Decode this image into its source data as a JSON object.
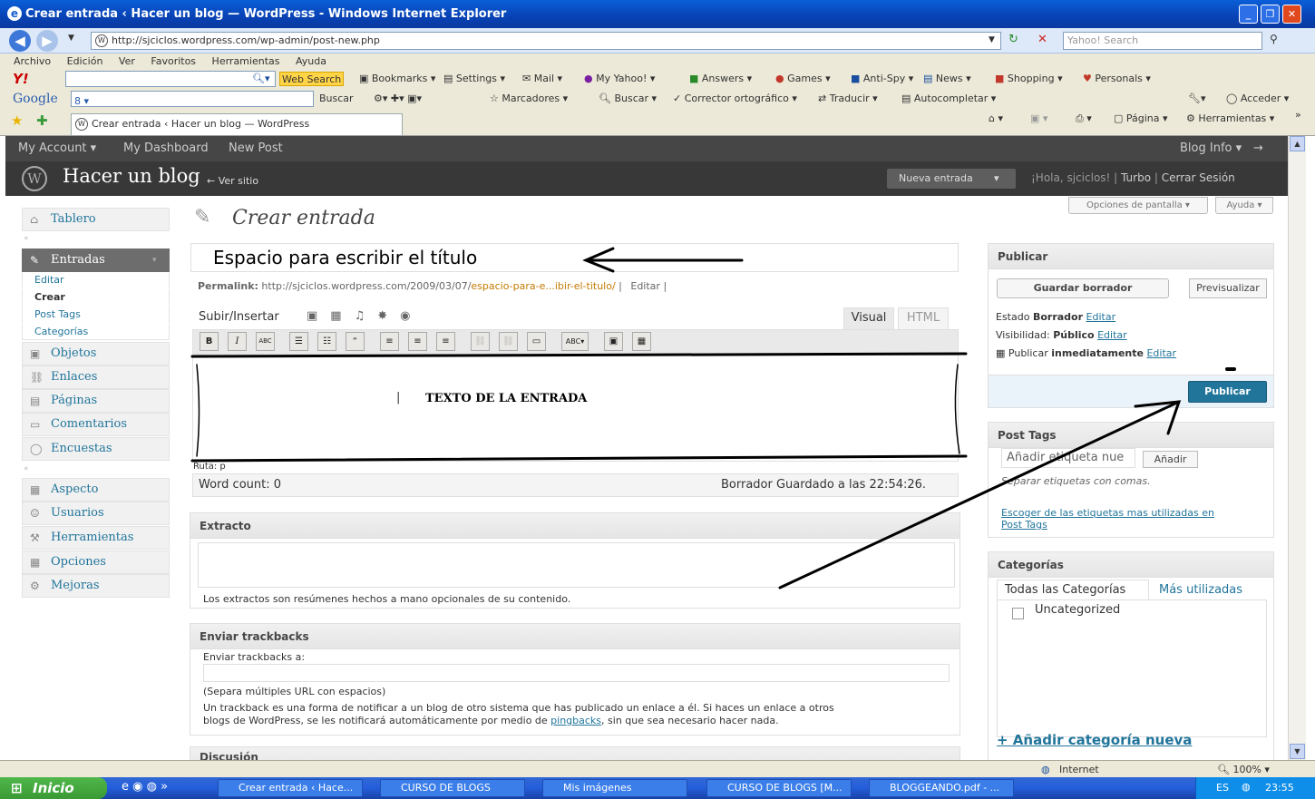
{
  "window": {
    "title": "Crear entrada ‹ Hacer un blog — WordPress - Windows Internet Explorer"
  },
  "address": {
    "url": "http://sjciclos.wordpress.com/wp-admin/post-new.php",
    "search_placeholder": "Yahoo! Search"
  },
  "menu": [
    "Archivo",
    "Edición",
    "Ver",
    "Favoritos",
    "Herramientas",
    "Ayuda"
  ],
  "yahoo_bar": {
    "web_search": "Web Search",
    "items": [
      "Bookmarks",
      "Settings",
      "Mail",
      "My Yahoo!",
      "Answers",
      "Games",
      "Anti-Spy",
      "News",
      "Shopping",
      "Personals"
    ]
  },
  "google_bar": {
    "logo": "Google",
    "buscar": "Buscar",
    "marcadores": "Marcadores",
    "buscar2": "Buscar",
    "corrector": "Corrector ortográfico",
    "traducir": "Traducir",
    "autocompletar": "Autocompletar",
    "acceder": "Acceder"
  },
  "tab": {
    "label": "Crear entrada ‹ Hacer un blog — WordPress",
    "pagina": "Página",
    "herramientas": "Herramientas"
  },
  "wp_admin_bar": {
    "my_account": "My Account",
    "my_dashboard": "My Dashboard",
    "new_post": "New Post",
    "blog_info": "Blog Info"
  },
  "wp_header": {
    "blog_title": "Hacer un blog",
    "ver_sitio": "← Ver sitio",
    "nueva_entrada": "Nueva entrada",
    "greeting": "¡Hola, sjciclos!",
    "turbo": "Turbo",
    "logout": "Cerrar Sesión"
  },
  "screen_options": "Opciones de pantalla",
  "ayuda": "Ayuda",
  "sidebar": {
    "tablero": "Tablero",
    "entradas": "Entradas",
    "entradas_sub": [
      "Editar",
      "Crear",
      "Post Tags",
      "Categorías"
    ],
    "items": [
      "Objetos",
      "Enlaces",
      "Páginas",
      "Comentarios",
      "Encuestas"
    ],
    "items2": [
      "Aspecto",
      "Usuarios",
      "Herramientas",
      "Opciones",
      "Mejoras"
    ]
  },
  "page_title": "Crear entrada",
  "post": {
    "title": "Espacio para escribir el título",
    "permalink_label": "Permalink:",
    "permalink_base": "http://sjciclos.wordpress.com/2009/03/07/",
    "permalink_slug": "espacio-para-e...ibir-el-titulo/",
    "permalink_edit": "Editar",
    "upload_insert": "Subir/Insertar",
    "tab_visual": "Visual",
    "tab_html": "HTML",
    "body_text": "TEXTO DE LA ENTRADA",
    "path": "Ruta: p",
    "word_count": "Word count: 0",
    "draft_saved": "Borrador Guardado a las 22:54:26."
  },
  "excerpt": {
    "title": "Extracto",
    "help": "Los extractos son resúmenes hechos a mano opcionales de su contenido."
  },
  "trackbacks": {
    "title": "Enviar trackbacks",
    "label": "Enviar trackbacks a:",
    "hint": "(Separa múltiples URL con espacios)",
    "desc1": "Un trackback es una forma de notificar a un blog de otro sistema que has publicado un enlace a él. Si haces un enlace a otros",
    "desc2a": "blogs de WordPress, se les notificará automáticamente por medio de ",
    "desc2link": "pingbacks",
    "desc2b": ", sin que sea necesario hacer nada."
  },
  "discussion": "Discusión",
  "publish": {
    "title": "Publicar",
    "save_draft": "Guardar borrador",
    "preview": "Previsualizar",
    "status_label": "Estado",
    "status_value": "Borrador",
    "visibility_label": "Visibilidad:",
    "visibility_value": "Público",
    "publish_label": "Publicar",
    "publish_value": "inmediatamente",
    "edit": "Editar",
    "publish_button": "Publicar"
  },
  "tags": {
    "title": "Post Tags",
    "placeholder": "Añadir etiqueta nue",
    "add": "Añadir",
    "hint": "Separar etiquetas con comas.",
    "popular1": "Escoger de las etiquetas mas utilizadas en",
    "popular2": "Post Tags"
  },
  "categories": {
    "title": "Categorías",
    "tab_all": "Todas las Categorías",
    "tab_popular": "Más utilizadas",
    "items": [
      "Uncategorized"
    ],
    "add_new": "+ Añadir categoría nueva"
  },
  "statusbar": {
    "zone": "Internet",
    "zoom": "100%"
  },
  "taskbar": {
    "start": "Inicio",
    "tasks": [
      "Crear entrada ‹ Hace...",
      "CURSO DE BLOGS",
      "Mis imágenes",
      "CURSO DE BLOGS [M...",
      "BLOGGEANDO.pdf - ..."
    ],
    "lang": "ES",
    "clock": "23:55"
  }
}
